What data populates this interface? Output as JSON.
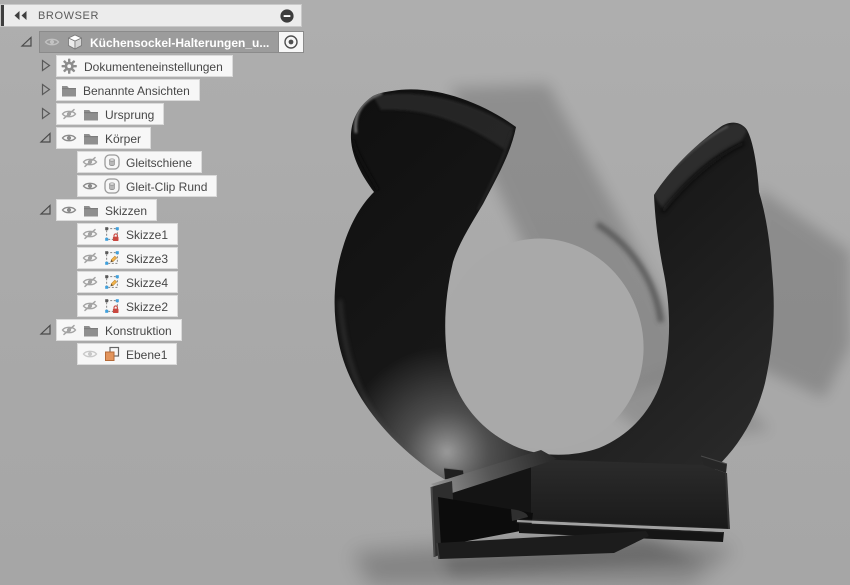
{
  "scene": {
    "background_color": "#ababab",
    "model_color": "#1a1a1a",
    "shadow_color": "#8f8f8f"
  },
  "browser": {
    "header": {
      "title": "BROWSER",
      "collapse_icon": "double-left-arrows-icon",
      "minimize_icon": "circle-minus-icon"
    },
    "tree": {
      "rows": [
        {
          "label": "Küchensockel-Halterungen_u...",
          "level": 0,
          "twisty": "expanded",
          "eye": "faint",
          "icon": "cube",
          "selected": true,
          "radio": true
        },
        {
          "label": "Dokumenteneinstellungen",
          "level": 1,
          "twisty": "collapsed",
          "eye": "none",
          "icon": "gear"
        },
        {
          "label": "Benannte Ansichten",
          "level": 1,
          "twisty": "collapsed",
          "eye": "none",
          "icon": "folder"
        },
        {
          "label": "Ursprung",
          "level": 1,
          "twisty": "collapsed",
          "eye": "hidden",
          "icon": "folder"
        },
        {
          "label": "Körper",
          "level": 1,
          "twisty": "expanded",
          "eye": "visible",
          "icon": "folder"
        },
        {
          "label": "Gleitschiene",
          "level": 2,
          "twisty": "none",
          "eye": "hidden",
          "icon": "body"
        },
        {
          "label": "Gleit-Clip Rund",
          "level": 2,
          "twisty": "none",
          "eye": "visible",
          "icon": "body"
        },
        {
          "label": "Skizzen",
          "level": 1,
          "twisty": "expanded",
          "eye": "visible",
          "icon": "folder"
        },
        {
          "label": "Skizze1",
          "level": 2,
          "twisty": "none",
          "eye": "hidden",
          "icon": "sketch-lock"
        },
        {
          "label": "Skizze3",
          "level": 2,
          "twisty": "none",
          "eye": "hidden",
          "icon": "sketch-pencil"
        },
        {
          "label": "Skizze4",
          "level": 2,
          "twisty": "none",
          "eye": "hidden",
          "icon": "sketch-pencil"
        },
        {
          "label": "Skizze2",
          "level": 2,
          "twisty": "none",
          "eye": "hidden",
          "icon": "sketch-lock"
        },
        {
          "label": "Konstruktion",
          "level": 1,
          "twisty": "expanded",
          "eye": "hidden",
          "icon": "folder"
        },
        {
          "label": "Ebene1",
          "level": 2,
          "twisty": "none",
          "eye": "faded",
          "icon": "plane"
        }
      ]
    }
  }
}
